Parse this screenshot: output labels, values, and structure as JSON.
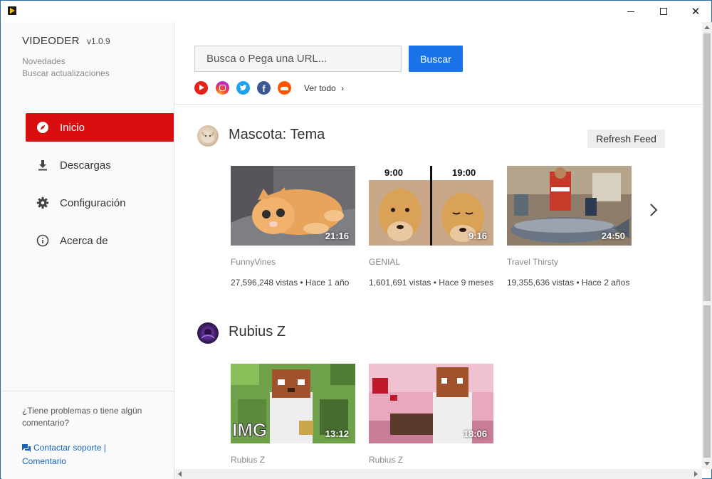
{
  "window": {
    "app_icon": "videoder-play-icon",
    "controls": [
      "minimize-icon",
      "maximize-icon",
      "close-icon"
    ]
  },
  "sidebar": {
    "brand": "VIDEODER",
    "version": "v1.0.9",
    "links": [
      "Novedades",
      "Buscar actualizaciones"
    ],
    "nav": [
      {
        "label": "Inicio",
        "icon": "compass-icon",
        "active": true
      },
      {
        "label": "Descargas",
        "icon": "download-icon",
        "active": false
      },
      {
        "label": "Configuración",
        "icon": "gear-icon",
        "active": false
      },
      {
        "label": "Acerca de",
        "icon": "info-icon",
        "active": false
      }
    ],
    "help_text": "¿Tiene problemas o tiene algún comentario?",
    "support_link": "Contactar soporte |",
    "comment_link": "Comentario"
  },
  "search": {
    "placeholder": "Busca o Pega una URL...",
    "button": "Buscar",
    "sources": [
      "youtube-icon",
      "instagram-icon",
      "twitter-icon",
      "facebook-icon",
      "soundcloud-icon"
    ],
    "see_all": "Ver todo"
  },
  "feeds": [
    {
      "title": "Mascota: Tema",
      "refresh": "Refresh Feed",
      "videos": [
        {
          "duration": "21:16",
          "channel": "FunnyVines",
          "meta": "27,596,248 vistas • Hace 1 año"
        },
        {
          "duration": "9:16",
          "channel": "GENIAL",
          "meta": "1,601,691 vistas • Hace 9 meses",
          "caption_left": "9:00",
          "caption_right": "19:00"
        },
        {
          "duration": "24:50",
          "channel": "Travel Thirsty",
          "meta": "19,355,636 vistas • Hace 2 años"
        }
      ]
    },
    {
      "title": "Rubius Z",
      "videos": [
        {
          "duration": "13:12",
          "channel": "Rubius Z",
          "thumb_text": "IMG"
        },
        {
          "duration": "18:06",
          "channel": "Rubius Z"
        }
      ]
    }
  ],
  "colors": {
    "accent_red": "#d90f0f",
    "button_blue": "#1a73e8",
    "link_blue": "#1565c0"
  }
}
